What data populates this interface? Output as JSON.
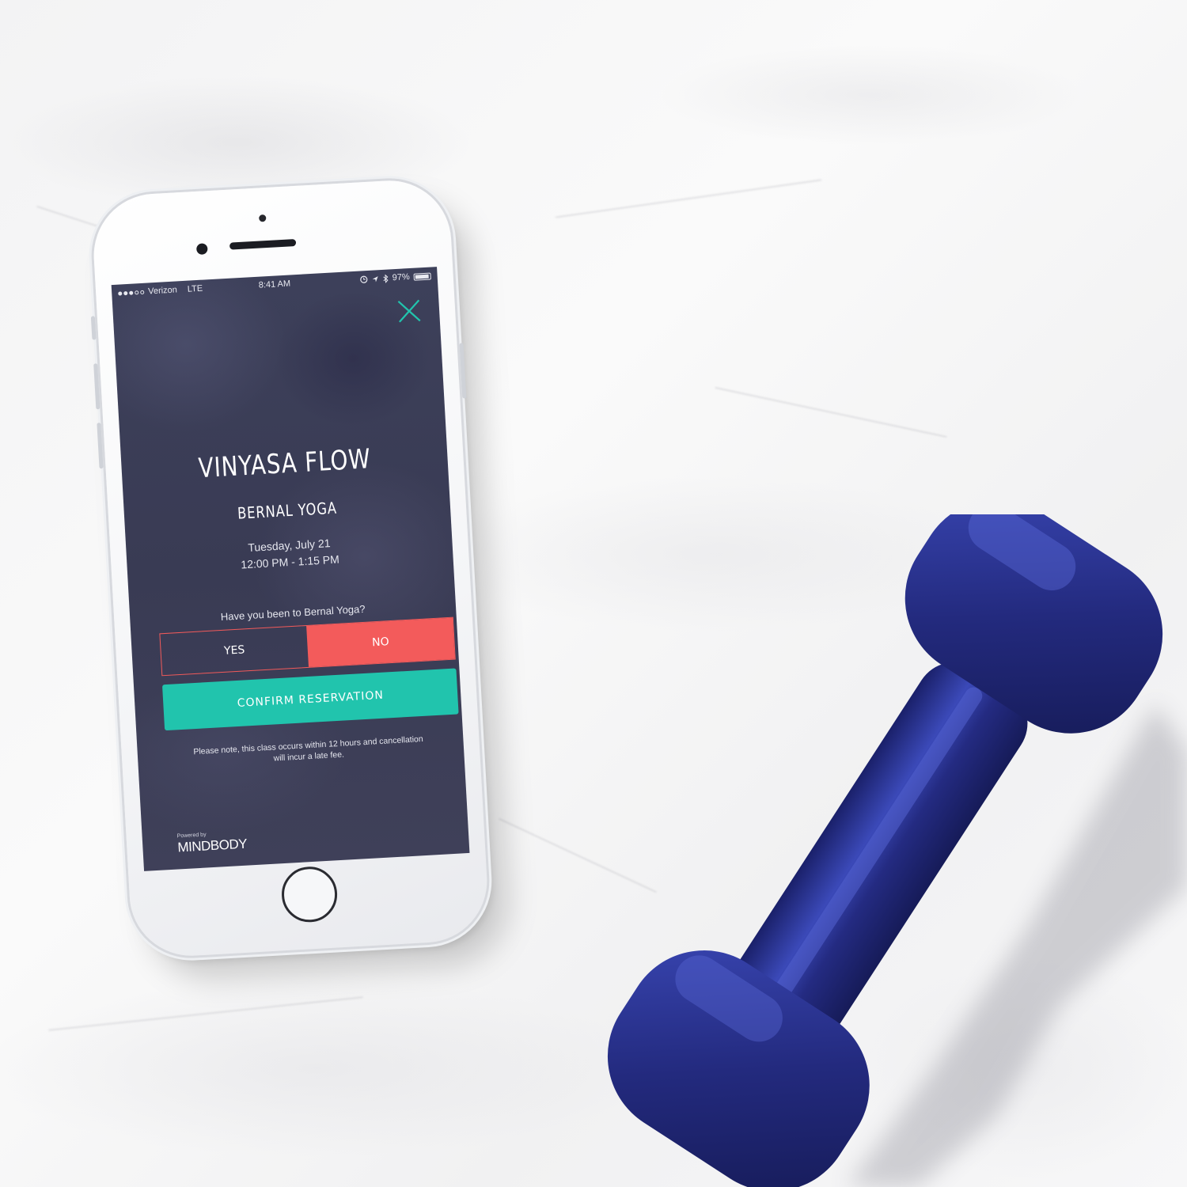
{
  "colors": {
    "screen_bg": "#3b3d57",
    "accent_teal": "#21c4ad",
    "accent_red": "#f35b5b",
    "dumbbell_blue": "#232a7e"
  },
  "status_bar": {
    "carrier": "Verizon",
    "network": "LTE",
    "time": "8:41 AM",
    "battery": "97%",
    "battery_level": 0.97
  },
  "reservation": {
    "class_name": "VINYASA FLOW",
    "studio_name": "BERNAL YOGA",
    "date": "Tuesday, July 21",
    "time_range": "12:00 PM - 1:15 PM",
    "question": "Have you been to Bernal Yoga?",
    "option_yes": "YES",
    "option_no": "NO",
    "selected_option": "NO",
    "confirm_label": "CONFIRM RESERVATION",
    "note_line1": "Please note, this class occurs within 12 hours and cancellation",
    "note_line2": "will incur a late fee."
  },
  "footer": {
    "powered_by": "Powered by",
    "brand": "MINDBODY"
  },
  "icons": {
    "close": "close-icon",
    "location": "location-icon",
    "bluetooth": "bluetooth-icon",
    "alarm": "alarm-icon"
  }
}
